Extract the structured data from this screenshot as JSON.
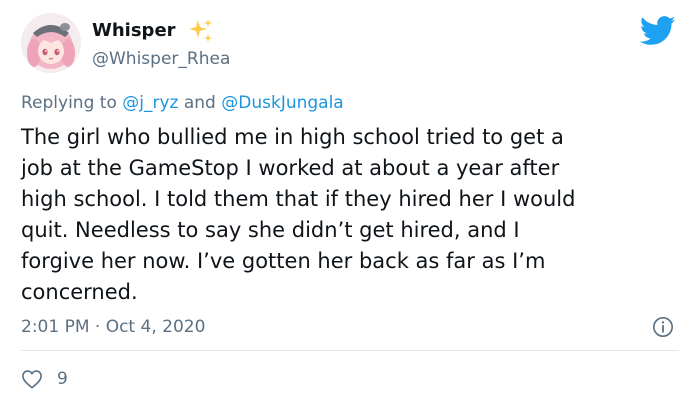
{
  "author": {
    "display_name": "Whisper",
    "handle": "@Whisper_Rhea",
    "avatar_icon": "anime-avatar-icon",
    "badge_icon": "sparkle-icon"
  },
  "reply": {
    "prefix": "Replying to",
    "mention_1": "@j_ryz",
    "conjunction": "and",
    "mention_2": "@DuskJungala"
  },
  "tweet": {
    "lines": [
      "The girl who bullied me in high school tried to get a",
      "job at the GameStop I worked at about a year after",
      "high school. I told them that if they hired her I would",
      "quit. Needless to say she didn’t get hired, and I",
      "forgive her now. I’ve gotten her back as far as I’m",
      "concerned."
    ]
  },
  "meta": {
    "timestamp": "2:01 PM · Oct 4, 2020"
  },
  "actions": {
    "like_count": "9"
  },
  "colors": {
    "twitter_blue": "#1da1f2",
    "mention_blue": "#1b95e0",
    "secondary_text": "#5b7083",
    "sparkle_yellow": "#ffcc4d"
  },
  "icons": {
    "logo": "twitter-bird-icon",
    "info": "info-icon",
    "like": "heart-icon"
  }
}
